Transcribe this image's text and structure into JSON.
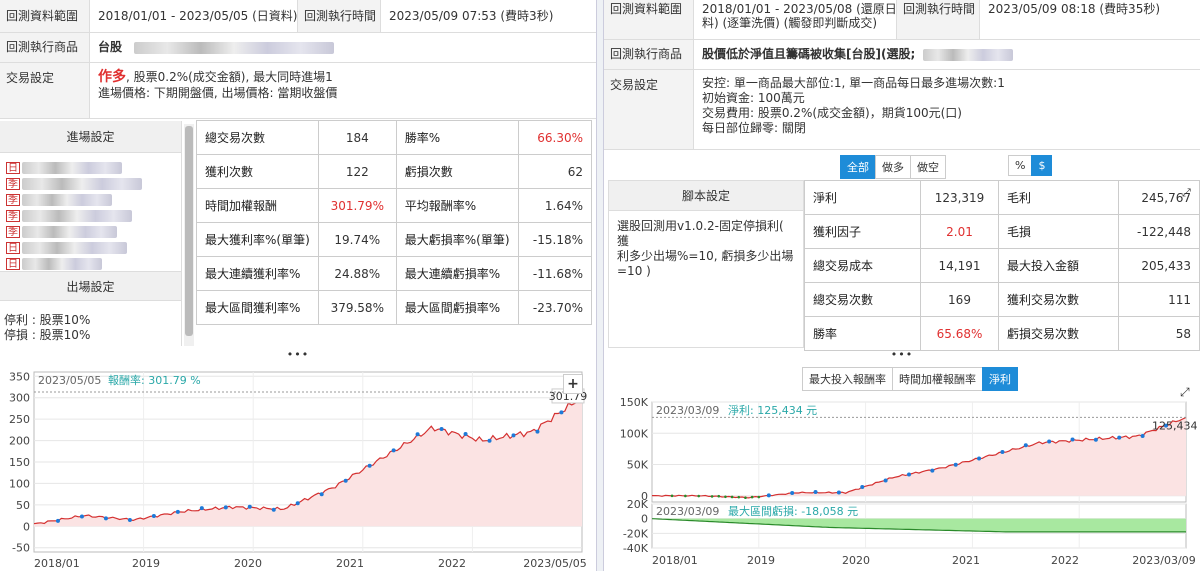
{
  "left": {
    "range_label": "回測資料範圍",
    "range_value": "2018/01/01 - 2023/05/05 (日資料)",
    "exec_time_label": "回測執行時間",
    "exec_time_value": "2023/05/09 07:53 (費時3秒)",
    "product_label": "回測執行商品",
    "product_value": "台股",
    "trade_label": "交易設定",
    "trade_direction": "作多",
    "trade_line1": ", 股票0.2%(成交金額), 最大同時進場1",
    "trade_line2": "進場價格: 下期開盤價, 出場價格: 當期收盤價",
    "entry_header": "進場設定",
    "entry_tags": [
      "日",
      "季",
      "季",
      "季",
      "季",
      "日",
      "日"
    ],
    "exit_header": "出場設定",
    "exit_lines": [
      "停利 : 股票10%",
      "停損 : 股票10%"
    ],
    "stats": [
      [
        "總交易次數",
        "184",
        "勝率%",
        "66.30%"
      ],
      [
        "獲利次數",
        "122",
        "虧損次數",
        "62"
      ],
      [
        "時間加權報酬",
        "301.79%",
        "平均報酬率%",
        "1.64%"
      ],
      [
        "最大獲利率%(單筆)",
        "19.74%",
        "最大虧損率%(單筆)",
        "-15.18%"
      ],
      [
        "最大連續獲利率%",
        "24.88%",
        "最大連續虧損率%",
        "-11.68%"
      ],
      [
        "最大區間獲利率%",
        "379.58%",
        "最大區間虧損率%",
        "-23.70%"
      ]
    ],
    "chart": {
      "date_label": "2023/05/05",
      "metric_label": "報酬率: 301.79 %",
      "end_value_label": "301.79",
      "plus": "+"
    }
  },
  "right": {
    "range_label": "回測資料範圍",
    "range_value_1": "2018/01/01 - 2023/05/08 (還原日資",
    "range_value_2": "料) (逐筆洗價) (觸發即判斷成交)",
    "exec_time_label": "回測執行時間",
    "exec_time_value": "2023/05/09 08:18 (費時35秒)",
    "product_label": "回測執行商品",
    "product_value": "股價低於淨值且籌碼被收集[台股](選股;",
    "trade_label": "交易設定",
    "trade_lines": [
      "安控: 單一商品最大部位:1, 單一商品每日最多進場次數:1",
      "初始資金: 100萬元",
      "交易費用: 股票0.2%(成交金額)，期貨100元(口)",
      "每日部位歸零: 關閉"
    ],
    "filter_buttons": [
      "全部",
      "做多",
      "做空"
    ],
    "unit_buttons": [
      "%",
      "$"
    ],
    "script_header": "腳本設定",
    "script_text": [
      "選股回測用v1.0.2-固定停損利( 獲",
      "利多少出場%=10, 虧損多少出場",
      "=10 )"
    ],
    "stats": [
      [
        "淨利",
        "123,319",
        "毛利",
        "245,767"
      ],
      [
        "獲利因子",
        "2.01",
        "毛損",
        "-122,448"
      ],
      [
        "總交易成本",
        "14,191",
        "最大投入金額",
        "205,433"
      ],
      [
        "總交易次數",
        "169",
        "獲利交易次數",
        "111"
      ],
      [
        "勝率",
        "65.68%",
        "虧損交易次數",
        "58"
      ]
    ],
    "chart_tabs": [
      "最大投入報酬率",
      "時間加權報酬率",
      "淨利"
    ],
    "chart": {
      "date_label": "2023/03/09",
      "metric_label": "淨利: 125,434 元",
      "end_value_label": "125,434",
      "dd_date_label": "2023/03/09",
      "dd_label": "最大區間虧損: -18,058 元",
      "x_end_label": "2023/03/09"
    }
  },
  "chart_data": [
    {
      "type": "area",
      "x": [
        "2018/01",
        "2018/07",
        "2019/01",
        "2019/07",
        "2020/01",
        "2020/07",
        "2021/01",
        "2021/07",
        "2022/01",
        "2022/07",
        "2023/01",
        "2023/05"
      ],
      "values": [
        5,
        25,
        15,
        35,
        45,
        40,
        90,
        160,
        230,
        200,
        220,
        301.79
      ],
      "xticks": [
        "2018/01",
        "2019",
        "2020",
        "2021",
        "2022",
        "2023/05/05"
      ],
      "ylim": [
        -60,
        360
      ],
      "yticks": [
        -50,
        0,
        50,
        100,
        150,
        200,
        250,
        300,
        350
      ],
      "grid": true
    },
    {
      "type": "area",
      "x": [
        "2018/01",
        "2018/07",
        "2019/01",
        "2019/07",
        "2020/01",
        "2020/07",
        "2021/01",
        "2021/07",
        "2022/01",
        "2022/07",
        "2023/01",
        "2023/03"
      ],
      "values": [
        0,
        0,
        -3000,
        5000,
        5000,
        30000,
        45000,
        65000,
        85000,
        90000,
        95000,
        125434
      ],
      "xticks": [
        "2018/01",
        "2019",
        "2020",
        "2021",
        "2022",
        "2023/03/09"
      ],
      "ylim": [
        -10000,
        150000
      ],
      "yticks": [
        -50000,
        0,
        50000,
        100000,
        150000
      ],
      "grid": true
    },
    {
      "type": "area",
      "x": [
        "2018/01",
        "2018/12",
        "2019/03",
        "2023/03"
      ],
      "values": [
        0,
        -12000,
        -18058,
        -18058
      ],
      "ylim": [
        -40000,
        20000
      ],
      "yticks": [
        -40000,
        -20000,
        0,
        20000
      ],
      "grid": true
    }
  ]
}
